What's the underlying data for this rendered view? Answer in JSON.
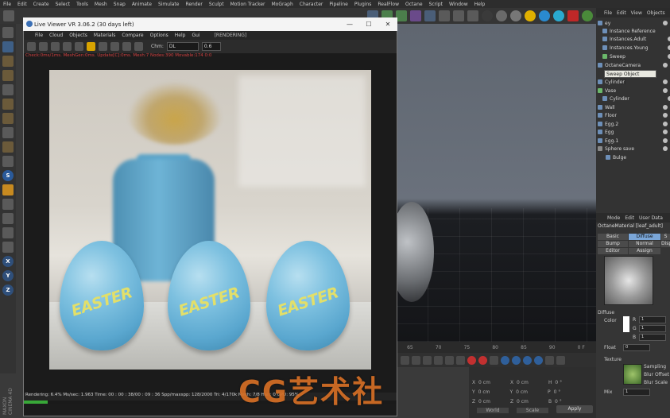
{
  "menubar": [
    "File",
    "Edit",
    "Create",
    "Select",
    "Tools",
    "Mesh",
    "Snap",
    "Animate",
    "Simulate",
    "Render",
    "Sculpt",
    "Motion Tracker",
    "MoGraph",
    "Character",
    "Pipeline",
    "Plugins",
    "RealFlow",
    "Octane",
    "Script",
    "Window",
    "Help"
  ],
  "left_tools": {
    "x": "X",
    "y": "Y",
    "z": "Z",
    "s": "S"
  },
  "maxon": "MAXON CINEMA 4D",
  "live_viewer": {
    "title": "Live Viewer VR 3.06.2 (30 days left)",
    "menu": [
      "File",
      "Cloud",
      "Objects",
      "Materials",
      "Compare",
      "Options",
      "Help",
      "Gui"
    ],
    "status_tag": "[RENDERING]",
    "chm_label": "Chm:",
    "chm_value": "DL",
    "zoom": "0.6",
    "stats_line": "Check:0ms/1ms. MeshGen:0ms. Update[C]:0ms. Mesh:7 Nodes:390 Movable:174  0:0",
    "render_status": "Rendering: 6.4%   Ms/sec: 1.963   Time: 00 : 00 : 38/00 : 09 : 36   Spp/maxspp: 128/2000   Tri: 4/170k   Mesh: 7/8   Hair: 0   GPU: 95%",
    "progress": 0.064,
    "egg_word": "EASTER"
  },
  "timeline": [
    "65",
    "70",
    "75",
    "80",
    "85",
    "90",
    "0 F"
  ],
  "coords": {
    "rows": [
      [
        "X",
        "0 cm",
        "X",
        "0 cm",
        "H",
        "0 °"
      ],
      [
        "Y",
        "0 cm",
        "Y",
        "0 cm",
        "P",
        "0 °"
      ],
      [
        "Z",
        "0 cm",
        "Z",
        "0 cm",
        "B",
        "0 °"
      ]
    ],
    "mode_a": "World",
    "mode_b": "Scale",
    "apply": "Apply"
  },
  "object_manager": {
    "menu": [
      "File",
      "Edit",
      "View",
      "Objects"
    ],
    "items": [
      "ey",
      "Instance Reference",
      "Instances.Adult",
      "Instances.Young",
      "Sweep",
      "OctaneCamera",
      "Sweep",
      "Cylinder",
      "Vase",
      "Cylinder",
      "Wall",
      "Floor",
      "Egg.2",
      "Egg",
      "Egg.1",
      "Sphere save",
      "Bulge"
    ],
    "tooltip": "Sweep Object [Sweep]"
  },
  "attribute_manager": {
    "menu": [
      "Mode",
      "Edit",
      "User Data"
    ],
    "material": "OctaneMaterial [leaf_adult]",
    "tabs": [
      "Basic",
      "Diffuse",
      "S",
      "Bump",
      "Normal",
      "Disp",
      "Editor",
      "Assign"
    ],
    "active_tab": "Diffuse",
    "section": "Diffuse",
    "color_label": "Color",
    "r_label": "R",
    "r_val": "1",
    "g_label": "G",
    "g_val": "1",
    "b_label": "B",
    "b_val": "1",
    "float_label": "Float",
    "float_val": "0",
    "texture_label": "Texture",
    "sampling": "Sampling",
    "blur_offset": "Blur Offset",
    "blur_scale": "Blur Scale",
    "mix_label": "Mix",
    "mix_val": "1"
  },
  "watermark": "CG艺术社"
}
